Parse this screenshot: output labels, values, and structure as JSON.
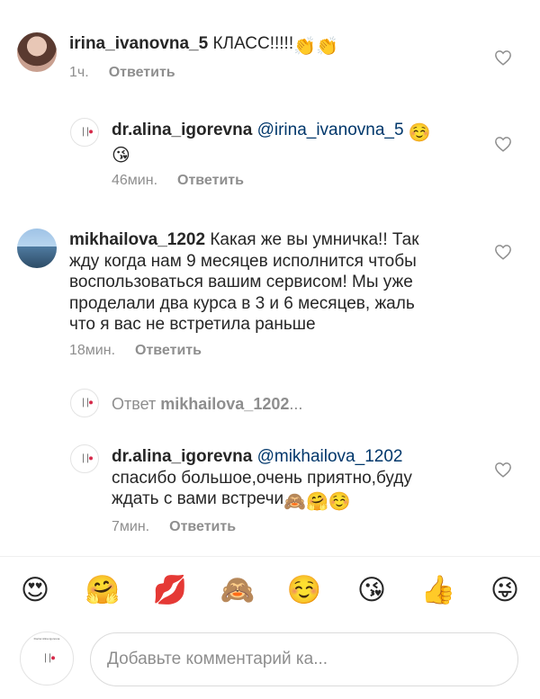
{
  "comments": [
    {
      "user": "irina_ivanovna_5",
      "text": " КЛАСС!!!!!",
      "emoji": "👏👏",
      "time": "1ч.",
      "reply_label": "Ответить",
      "avatar_icon": "woman-portrait"
    },
    {
      "user": "dr.alina_igorevna",
      "mention": "@irina_ivanovna_5",
      "emoji_inline": "☺️",
      "emoji_line2": "😘",
      "time": "46мин.",
      "reply_label": "Ответить",
      "avatar_icon": "doctor-logo"
    },
    {
      "user": "mikhailova_1202",
      "line1": " Какая же вы умничка!! Так",
      "line2": "жду когда нам 9 месяцев исполнится чтобы",
      "line3": "воспользоваться вашим сервисом! Мы уже",
      "line4": "проделали два курса в 3 и 6 месяцев, жаль",
      "line5": "что я вас не встретила раньше",
      "time": "18мин.",
      "reply_label": "Ответить",
      "avatar_icon": "beach-photo"
    },
    {
      "user": "dr.alina_igorevna",
      "mention": "@mikhailova_1202",
      "line2": "спасибо большое,очень приятно,буду",
      "line3": "ждать с вами встречи",
      "emoji": "🙈🤗☺️",
      "time": "7мин.",
      "reply_label": "Ответить",
      "avatar_icon": "doctor-logo"
    }
  ],
  "replies_toggle": {
    "prefix": "Ответ ",
    "user": "mikhailova_1202",
    "suffix": "..."
  },
  "emoji_bar": [
    "😍",
    "🤗",
    "💋",
    "🙈",
    "☺️",
    "😘",
    "👍",
    "😜"
  ],
  "composer": {
    "placeholder": "Добавьте комментарий ка...",
    "avatar_text": "Doctor Alina Igorevna"
  },
  "colors": {
    "mention": "#00376b",
    "meta": "#8e8e8e",
    "text": "#262626"
  }
}
